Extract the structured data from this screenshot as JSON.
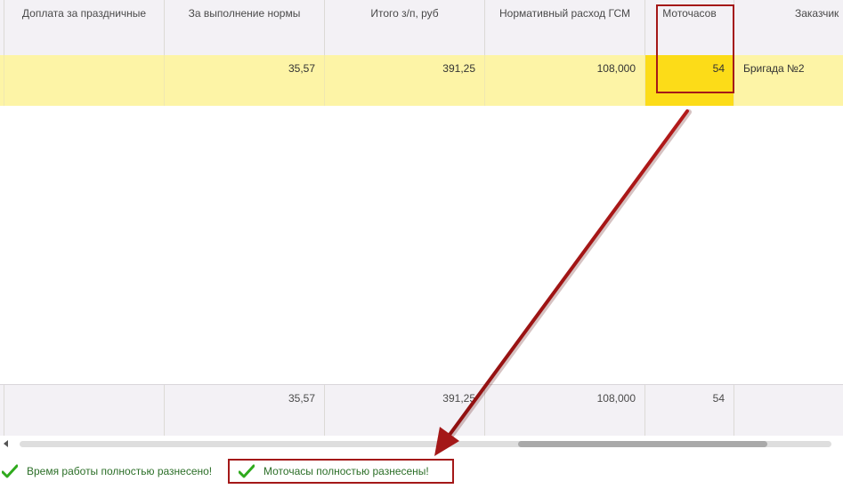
{
  "columns": [
    {
      "label": "Доплата за праздничные"
    },
    {
      "label": "За выполнение нормы"
    },
    {
      "label": "Итого з/п, руб"
    },
    {
      "label": "Нормативный расход ГСМ"
    },
    {
      "label": "Моточасов"
    },
    {
      "label": "Заказчик"
    }
  ],
  "rows": [
    {
      "holiday_pay": "",
      "norm_bonus": "35,57",
      "total_salary": "391,25",
      "fuel_norm": "108,000",
      "engine_hours": "54",
      "customer": "Бригада №2"
    }
  ],
  "totals": {
    "holiday_pay": "",
    "norm_bonus": "35,57",
    "total_salary": "391,25",
    "fuel_norm": "108,000",
    "engine_hours": "54",
    "customer": ""
  },
  "status": {
    "work_time": "Время работы полностью разнесено!",
    "engine_hours": "Моточасы полностью разнесены!"
  },
  "colors": {
    "selected_row": "#fdf4a6",
    "selected_cell": "#fcdc18",
    "annotation": "#a41818",
    "status_text": "#2c6f28",
    "check": "#2faa1d"
  },
  "icons": {
    "status_check": "check-icon",
    "scroll_left": "chevron-left-icon"
  }
}
